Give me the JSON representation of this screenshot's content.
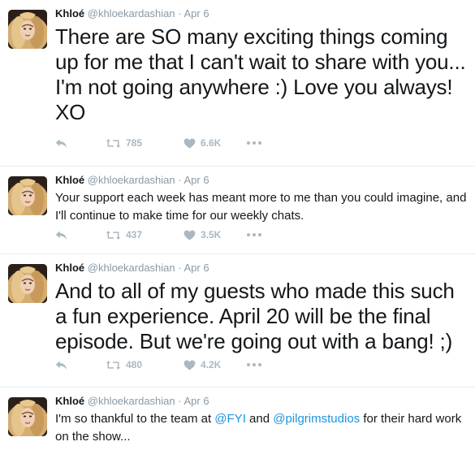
{
  "tweets": [
    {
      "name": "Khloé",
      "handle": "@khloekardashian",
      "separator": "·",
      "time": "Apr 6",
      "text": "There are SO many exciting things coming up for me that I can't wait to share with you... I'm not going anywhere :) Love you always! XO",
      "retweets": "785",
      "likes": "6.6K"
    },
    {
      "name": "Khloé",
      "handle": "@khloekardashian",
      "separator": "·",
      "time": "Apr 6",
      "text": "Your support each week has meant more to me than you could imagine, and I'll continue to make time for our weekly chats.",
      "retweets": "437",
      "likes": "3.5K"
    },
    {
      "name": "Khloé",
      "handle": "@khloekardashian",
      "separator": "·",
      "time": "Apr 6",
      "text": "And to all of my guests who made this such a fun experience. April 20 will be the final episode. But we're going out with a bang! ;)",
      "retweets": "480",
      "likes": "4.2K"
    },
    {
      "name": "Khloé",
      "handle": "@khloekardashian",
      "separator": "·",
      "time": "Apr 6",
      "text_parts": [
        "I'm so thankful to the team at ",
        "@FYI",
        " and ",
        "@pilgrimstudios",
        " for their hard work on the show..."
      ]
    }
  ],
  "colors": {
    "text": "#14171a",
    "muted": "#8899a6",
    "icon": "#aab8c2",
    "link": "#1b95e0",
    "divider": "#e6ecf0"
  },
  "icons": [
    "reply-icon",
    "retweet-icon",
    "heart-icon",
    "more-icon"
  ]
}
